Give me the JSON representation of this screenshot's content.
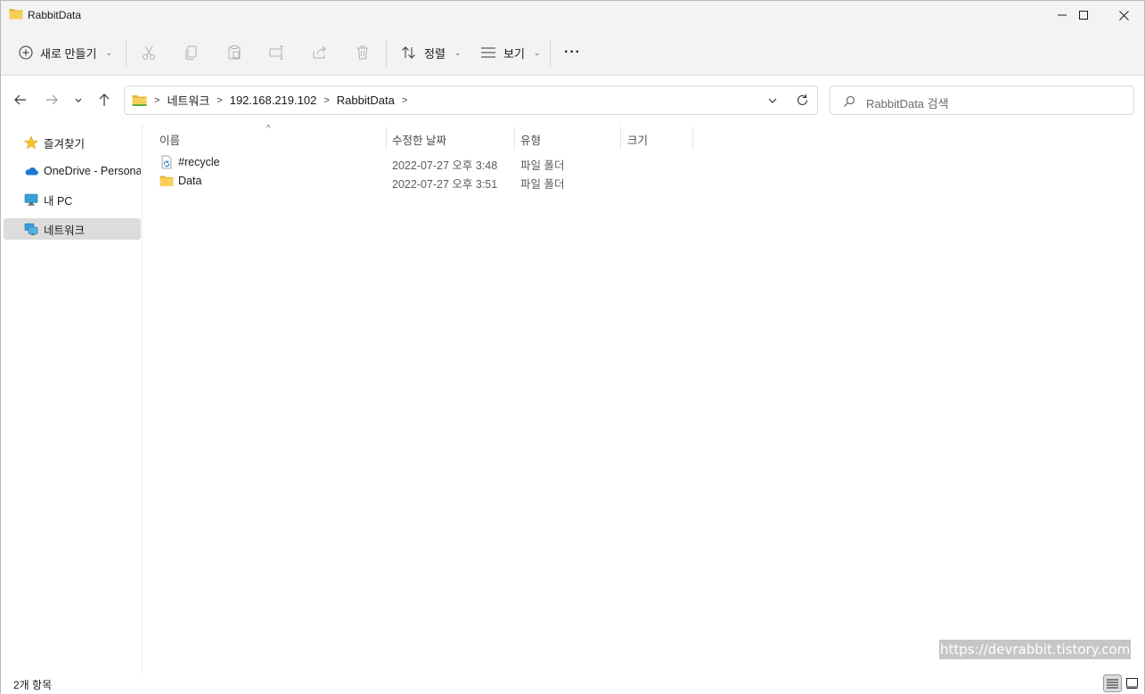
{
  "window": {
    "title": "RabbitData",
    "minimize_label": "",
    "maximize_label": "",
    "close_label": ""
  },
  "toolbar": {
    "new_label": "새로 만들기",
    "sort_label": "정렬",
    "view_label": "보기",
    "more_label": "···"
  },
  "address": {
    "crumbs": [
      "네트워크",
      "192.168.219.102",
      "RabbitData"
    ],
    "separator": ">"
  },
  "search": {
    "placeholder": "RabbitData 검색"
  },
  "sidebar": {
    "items": [
      {
        "label": "즐겨찾기",
        "icon": "star-icon"
      },
      {
        "label": "OneDrive - Personal",
        "icon": "cloud-icon"
      },
      {
        "label": "내 PC",
        "icon": "monitor-icon"
      },
      {
        "label": "네트워크",
        "icon": "network-icon"
      }
    ],
    "selected_index": 3
  },
  "columns": {
    "name": "이름",
    "date": "수정한 날짜",
    "type": "유형",
    "size": "크기"
  },
  "files": [
    {
      "name": "#recycle",
      "date": "2022-07-27 오후 3:48",
      "type": "파일 폴더",
      "icon": "recycle-folder-icon"
    },
    {
      "name": "Data",
      "date": "2022-07-27 오후 3:51",
      "type": "파일 폴더",
      "icon": "folder-icon"
    }
  ],
  "status": {
    "item_count": "2개 항목"
  },
  "watermark": "https://devrabbit.tistory.com",
  "colors": {
    "chrome_bg": "#f3f3f3",
    "selected_bg": "#dcdcdc",
    "folder_yellow": "#f5c643",
    "accent_blue": "#0067c0"
  }
}
